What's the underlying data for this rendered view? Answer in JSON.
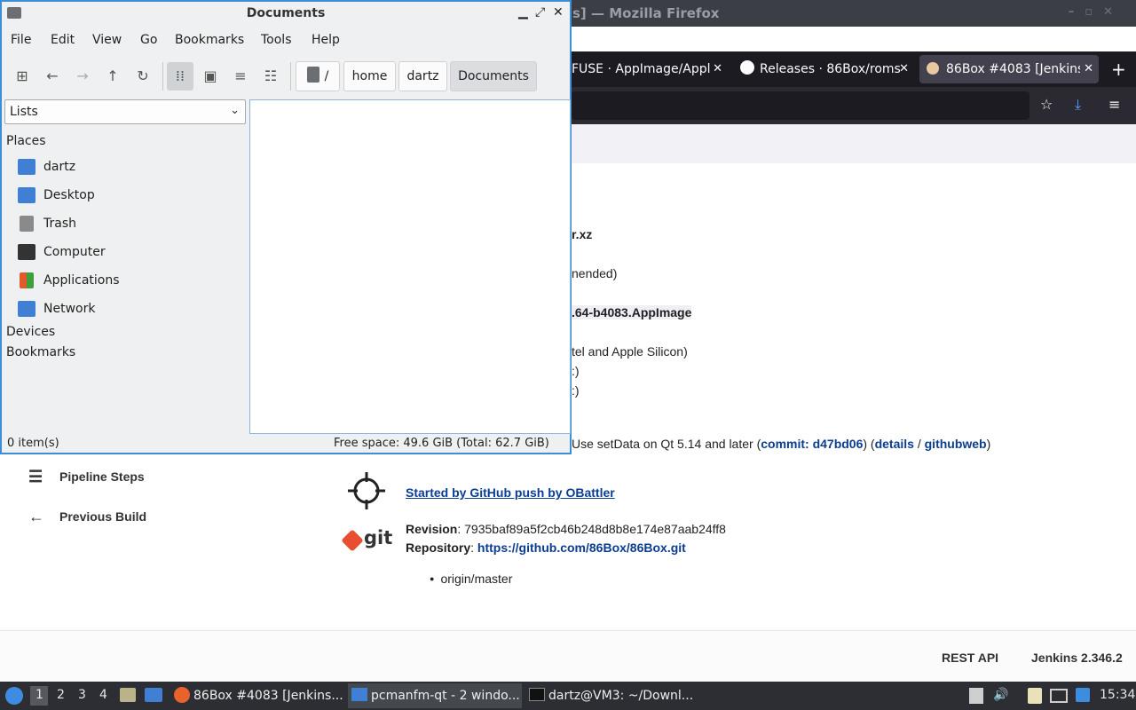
{
  "firefox": {
    "window_title": "s] — Mozilla Firefox",
    "tabs": [
      {
        "label": "FUSE · AppImage/Appl",
        "close": "✕"
      },
      {
        "label": "Releases · 86Box/roms",
        "close": "✕"
      },
      {
        "label": "86Box #4083 [Jenkins",
        "close": "✕"
      }
    ],
    "new_tab": "+"
  },
  "jenkins": {
    "lines": [
      {
        "text": "r.xz",
        "bold": true
      },
      {
        "text": "nended)",
        "bold": false
      },
      {
        "text": ".64-b4083.AppImage",
        "bold": true
      },
      {
        "text": "tel and Apple Silicon)",
        "bold": false
      },
      {
        "text": ":)",
        "bold": false
      },
      {
        "text": ":)",
        "bold": false
      }
    ],
    "commit_prefix": "Use setData on Qt 5.14 and later (",
    "commit_link": "commit: d47bd06",
    "commit_mid1": ") (",
    "details_link": "details",
    "commit_slash": " / ",
    "githubweb_link": "githubweb",
    "commit_end": ")",
    "started_by": "Started by GitHub push by OBattler",
    "revision_label": "Revision",
    "revision_value": ": 7935baf89a5f2cb46b248d8b8e174e87aab24ff8",
    "repository_label": "Repository",
    "repository_colon": ": ",
    "repository_url": "https://github.com/86Box/86Box.git",
    "branch": "origin/master",
    "git_logo": "git",
    "sidebar": [
      {
        "label": "Pipeline Steps",
        "icon": "list-icon"
      },
      {
        "label": "Previous Build",
        "icon": "arrow-left-icon"
      }
    ],
    "footer": {
      "rest_api": "REST API",
      "version": "Jenkins 2.346.2"
    }
  },
  "file_manager": {
    "title": "Documents",
    "menu": [
      "File",
      "Edit",
      "View",
      "Go",
      "Bookmarks",
      "Tools",
      "Help"
    ],
    "breadcrumbs": [
      "/",
      "home",
      "dartz",
      "Documents"
    ],
    "side_pane_mode": "Lists",
    "places_header": "Places",
    "places": [
      {
        "label": "dartz",
        "icon": "home-folder-icon",
        "color": "#3f7fd4"
      },
      {
        "label": "Desktop",
        "icon": "desktop-icon",
        "color": "#3f7fd4"
      },
      {
        "label": "Trash",
        "icon": "trash-icon",
        "color": "#8a8a8a"
      },
      {
        "label": "Computer",
        "icon": "computer-icon",
        "color": "#333333"
      },
      {
        "label": "Applications",
        "icon": "applications-icon",
        "color": "#e05a2a"
      },
      {
        "label": "Network",
        "icon": "network-icon",
        "color": "#3f7fd4"
      }
    ],
    "devices_header": "Devices",
    "bookmarks_header": "Bookmarks",
    "status_items": "0 item(s)",
    "status_space": "Free space: 49.6 GiB (Total: 62.7 GiB)"
  },
  "taskbar": {
    "workspaces": [
      "1",
      "2",
      "3",
      "4"
    ],
    "tasks": [
      {
        "label": "86Box #4083 [Jenkins..."
      },
      {
        "label": "pcmanfm-qt - 2 windo..."
      },
      {
        "label": "dartz@VM3: ~/Downl..."
      }
    ],
    "clock": "15:34"
  }
}
